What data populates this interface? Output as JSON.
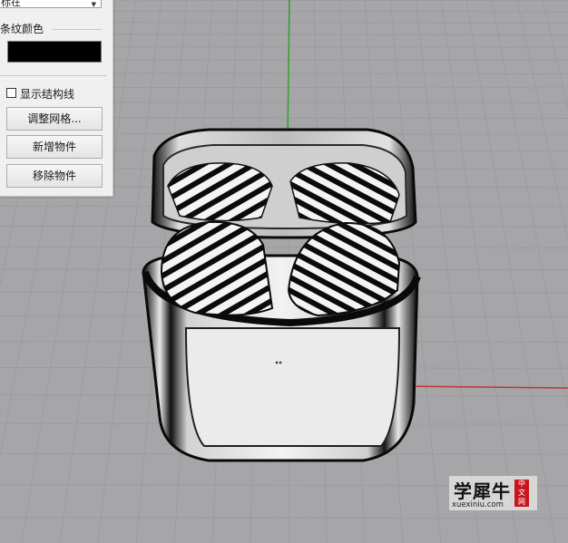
{
  "panel": {
    "dropdown_value": "标在",
    "stripe_color_label": "条纹颜色",
    "stripe_color": "#000000",
    "show_structure_lines": {
      "label": "显示结构线",
      "checked": false
    },
    "buttons": {
      "adjust_mesh": "调整网格...",
      "add_object": "新增物件",
      "remove_object": "移除物件"
    }
  },
  "viewport": {
    "background": "#a6a6a8",
    "grid_color": "#9a9a9c",
    "x_axis_color": "#c03434",
    "y_axis_color": "#2ea32e"
  },
  "watermark": {
    "brand": "学犀牛",
    "seal": [
      "中",
      "文",
      "网"
    ],
    "url": "xuexiniu.com"
  }
}
